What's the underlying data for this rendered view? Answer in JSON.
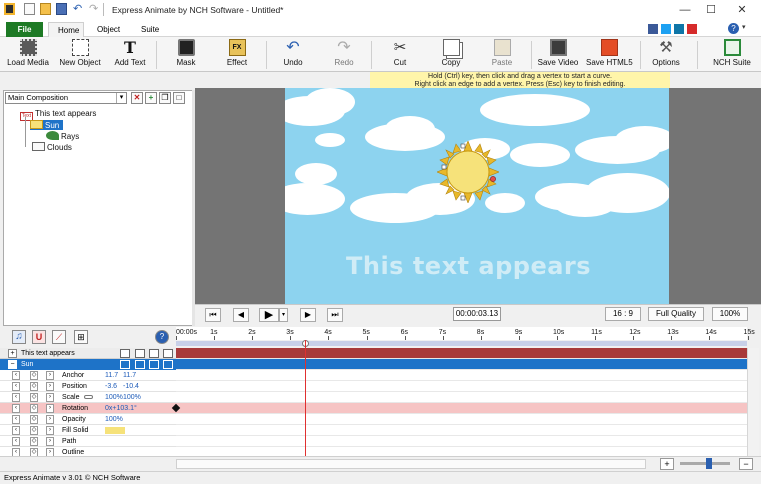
{
  "window": {
    "title": "Express Animate by NCH Software - Untitled*"
  },
  "tabs": {
    "file": "File",
    "home": "Home",
    "object": "Object",
    "suite": "Suite"
  },
  "toolbar": {
    "load_media": "Load Media",
    "new_object": "New Object",
    "add_text": "Add Text",
    "mask": "Mask",
    "effect": "Effect",
    "undo": "Undo",
    "redo": "Redo",
    "cut": "Cut",
    "copy": "Copy",
    "paste": "Paste",
    "save_video": "Save Video",
    "save_html5": "Save HTML5",
    "options": "Options",
    "nch_suite": "NCH Suite"
  },
  "hint": {
    "line1": "Hold (Ctrl) key, then click and drag a vertex to start a curve.",
    "line2": "Right click an edge to add a vertex. Press (Esc) key to finish editing."
  },
  "composition": {
    "selected": "Main Composition"
  },
  "tree": [
    {
      "label": "This text appears",
      "badge": "Text"
    },
    {
      "label": "Sun"
    },
    {
      "label": "Rays"
    },
    {
      "label": "Clouds"
    }
  ],
  "canvas": {
    "overlay_text": "This text appears"
  },
  "transport": {
    "time": "00:00:03.13",
    "aspect": "16 : 9",
    "quality": "Full Quality",
    "zoom": "100%"
  },
  "ruler": {
    "ticks": [
      "00:00s",
      "1s",
      "2s",
      "3s",
      "4s",
      "5s",
      "6s",
      "7s",
      "8s",
      "9s",
      "10s",
      "11s",
      "12s",
      "13s",
      "14s",
      "15s"
    ]
  },
  "tracks": {
    "text_track": "This text appears",
    "sun_track": "Sun",
    "properties": [
      {
        "name": "Anchor",
        "v1": "11.7",
        "v2": "11.7"
      },
      {
        "name": "Position",
        "v1": "-3.6",
        "v2": "-10.4"
      },
      {
        "name": "Scale",
        "v1": "100%",
        "v2": "100%"
      },
      {
        "name": "Rotation",
        "v1": "0x+103.1°",
        "v2": ""
      },
      {
        "name": "Opacity",
        "v1": "100%",
        "v2": ""
      },
      {
        "name": "Fill Solid",
        "v1": "",
        "v2": ""
      },
      {
        "name": "Path",
        "v1": "",
        "v2": ""
      },
      {
        "name": "Outline",
        "v1": "",
        "v2": ""
      }
    ]
  },
  "status": {
    "text": "Express Animate v 3.01 © NCH Software"
  },
  "colors": {
    "file_tab": "#1e7a25",
    "sky": "#8dd3ef",
    "text_track": "#a83a3a",
    "sun_track": "#1e73c8",
    "rotation_row": "#f6c4c4",
    "sun": "#f6e27a"
  }
}
